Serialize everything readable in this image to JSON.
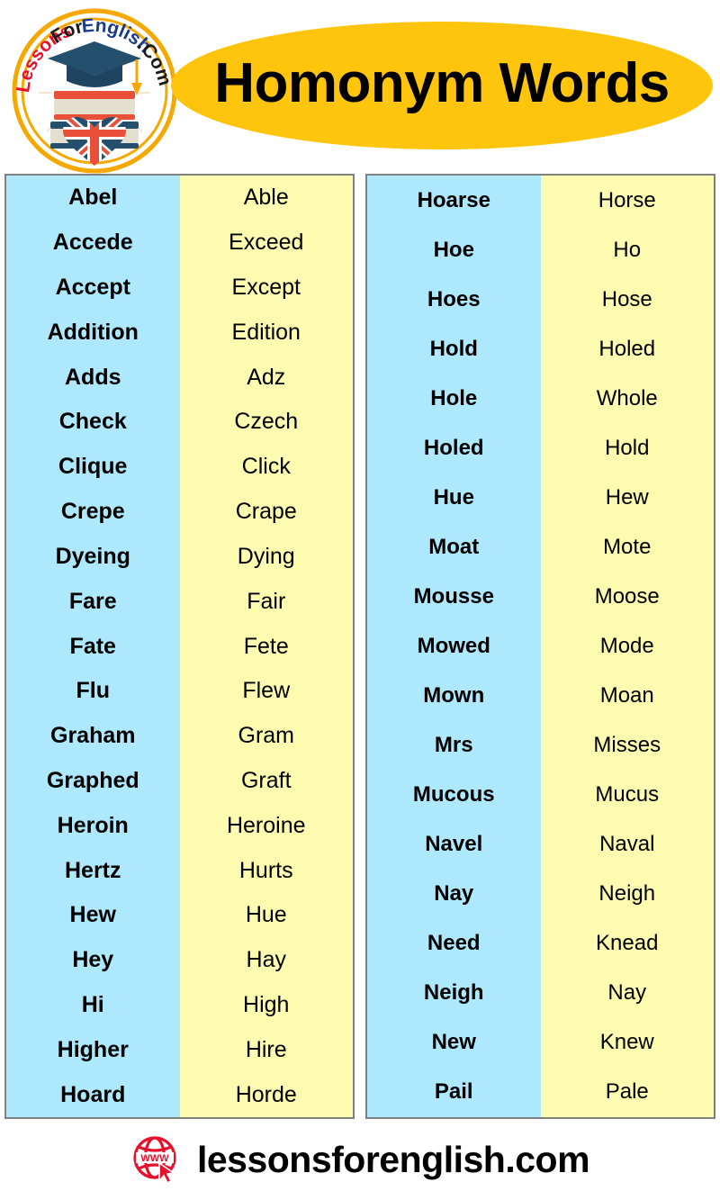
{
  "header": {
    "title": "Homonym Words",
    "ellipse_color": "#FFC40C",
    "logo": {
      "name": "lessons-for-english-logo",
      "text_parts": [
        "Lessons",
        "For",
        "English",
        ".Com"
      ],
      "colors": {
        "lessons": "#E8112D",
        "for": "#1A1A1A",
        "english": "#1B3C8C",
        "com": "#1A1A1A",
        "ring": "#F5A800"
      }
    }
  },
  "colors": {
    "left_column_bg": "#AEE8FC",
    "right_column_bg": "#FCFBAF",
    "table_border": "#808080",
    "text": "#000000",
    "accent_amber": "#FFC40C",
    "accent_red": "#E8112D"
  },
  "tables": [
    {
      "name": "homonym-table-left",
      "rows": [
        {
          "word": "Abel",
          "homonym": "Able"
        },
        {
          "word": "Accede",
          "homonym": "Exceed"
        },
        {
          "word": "Accept",
          "homonym": "Except"
        },
        {
          "word": "Addition",
          "homonym": "Edition"
        },
        {
          "word": "Adds",
          "homonym": "Adz"
        },
        {
          "word": "Check",
          "homonym": "Czech"
        },
        {
          "word": "Clique",
          "homonym": "Click"
        },
        {
          "word": "Crepe",
          "homonym": "Crape"
        },
        {
          "word": "Dyeing",
          "homonym": "Dying"
        },
        {
          "word": "Fare",
          "homonym": "Fair"
        },
        {
          "word": "Fate",
          "homonym": "Fete"
        },
        {
          "word": "Flu",
          "homonym": "Flew"
        },
        {
          "word": "Graham",
          "homonym": "Gram"
        },
        {
          "word": "Graphed",
          "homonym": "Graft"
        },
        {
          "word": "Heroin",
          "homonym": "Heroine"
        },
        {
          "word": "Hertz",
          "homonym": "Hurts"
        },
        {
          "word": "Hew",
          "homonym": "Hue"
        },
        {
          "word": "Hey",
          "homonym": "Hay"
        },
        {
          "word": "Hi",
          "homonym": "High"
        },
        {
          "word": "Higher",
          "homonym": "Hire"
        },
        {
          "word": "Hoard",
          "homonym": "Horde"
        }
      ]
    },
    {
      "name": "homonym-table-right",
      "rows": [
        {
          "word": "Hoarse",
          "homonym": "Horse"
        },
        {
          "word": "Hoe",
          "homonym": "Ho"
        },
        {
          "word": "Hoes",
          "homonym": "Hose"
        },
        {
          "word": "Hold",
          "homonym": "Holed"
        },
        {
          "word": "Hole",
          "homonym": "Whole"
        },
        {
          "word": "Holed",
          "homonym": "Hold"
        },
        {
          "word": "Hue",
          "homonym": "Hew"
        },
        {
          "word": "Moat",
          "homonym": "Mote"
        },
        {
          "word": "Mousse",
          "homonym": "Moose"
        },
        {
          "word": "Mowed",
          "homonym": "Mode"
        },
        {
          "word": "Mown",
          "homonym": "Moan"
        },
        {
          "word": "Mrs",
          "homonym": "Misses"
        },
        {
          "word": "Mucous",
          "homonym": "Mucus"
        },
        {
          "word": "Navel",
          "homonym": "Naval"
        },
        {
          "word": "Nay",
          "homonym": "Neigh"
        },
        {
          "word": "Need",
          "homonym": "Knead"
        },
        {
          "word": "Neigh",
          "homonym": "Nay"
        },
        {
          "word": "New",
          "homonym": "Knew"
        },
        {
          "word": "Pail",
          "homonym": "Pale"
        }
      ]
    }
  ],
  "footer": {
    "site": "lessonsforenglish.com",
    "icon": "www-globe-cursor-icon",
    "icon_color": "#E8112D",
    "globe_label": "WWW"
  }
}
